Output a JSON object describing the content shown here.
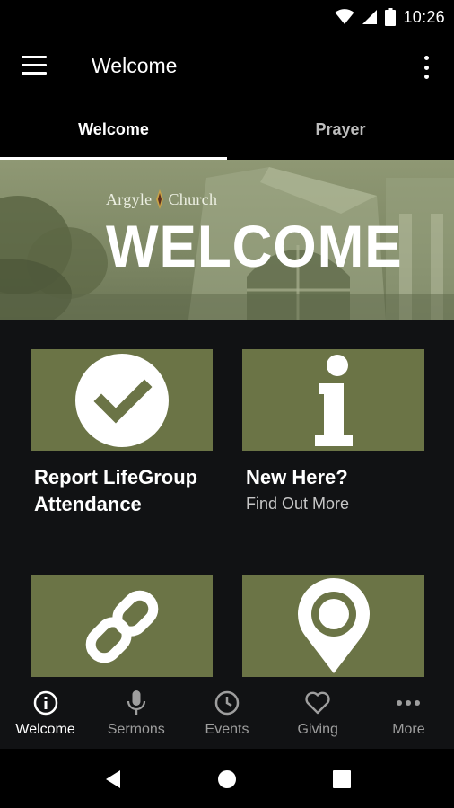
{
  "status_bar": {
    "time": "10:26",
    "icons": [
      "wifi-icon",
      "signal-icon",
      "battery-icon"
    ]
  },
  "app_bar": {
    "title": "Welcome",
    "menu_icon": "hamburger-menu-icon",
    "overflow_icon": "more-vert-icon"
  },
  "tabs": [
    {
      "label": "Welcome",
      "active": true
    },
    {
      "label": "Prayer",
      "active": false
    }
  ],
  "hero": {
    "logo_text_left": "Argyle",
    "logo_text_right": "Church",
    "title": "WELCOME"
  },
  "tiles": [
    {
      "icon": "checkmark-circle-icon",
      "title": "Report LifeGroup Attendance",
      "subtitle": ""
    },
    {
      "icon": "info-icon",
      "title": "New Here?",
      "subtitle": "Find Out More"
    },
    {
      "icon": "link-icon",
      "title": "",
      "subtitle": ""
    },
    {
      "icon": "map-pin-icon",
      "title": "",
      "subtitle": ""
    }
  ],
  "bottom_nav": [
    {
      "label": "Welcome",
      "icon": "info-circle-icon",
      "active": true
    },
    {
      "label": "Sermons",
      "icon": "microphone-icon",
      "active": false
    },
    {
      "label": "Events",
      "icon": "clock-icon",
      "active": false
    },
    {
      "label": "Giving",
      "icon": "heart-icon",
      "active": false
    },
    {
      "label": "More",
      "icon": "more-horiz-icon",
      "active": false
    }
  ],
  "system_nav": [
    "back-icon",
    "home-icon",
    "recents-icon"
  ],
  "colors": {
    "accent_tile": "#6b7446",
    "background": "#111214",
    "bar": "#000000"
  }
}
